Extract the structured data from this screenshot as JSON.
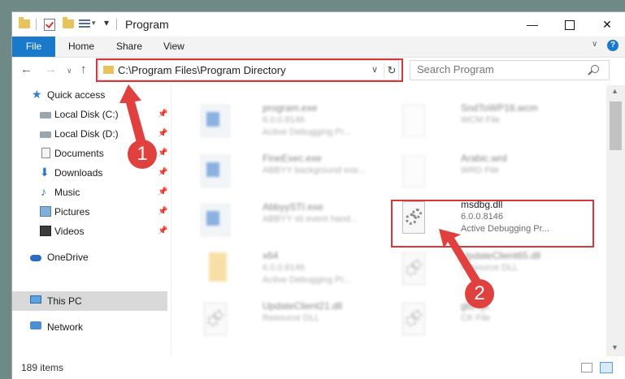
{
  "window": {
    "title": "Program",
    "minimize_glyph": "—",
    "close_glyph": "✕"
  },
  "ribbon": {
    "tabs": [
      "File",
      "Home",
      "Share",
      "View"
    ],
    "help_glyph": "?"
  },
  "address": {
    "path": "C:\\Program Files\\Program Directory",
    "dropdown_glyph": "∨",
    "refresh_glyph": "↻"
  },
  "search": {
    "placeholder": "Search Program"
  },
  "sidebar": {
    "items": [
      {
        "label": "Quick access",
        "icon": "star-icon",
        "pinned": false
      },
      {
        "label": "Local Disk (C:)",
        "icon": "drive-icon",
        "pinned": true
      },
      {
        "label": "Local Disk (D:)",
        "icon": "drive-icon",
        "pinned": true
      },
      {
        "label": "Documents",
        "icon": "documents-icon",
        "pinned": true
      },
      {
        "label": "Downloads",
        "icon": "download-icon",
        "pinned": true
      },
      {
        "label": "Music",
        "icon": "music-icon",
        "pinned": true
      },
      {
        "label": "Pictures",
        "icon": "pictures-icon",
        "pinned": true
      },
      {
        "label": "Videos",
        "icon": "videos-icon",
        "pinned": true
      },
      {
        "label": "OneDrive",
        "icon": "cloud-icon",
        "pinned": false
      },
      {
        "label": "This PC",
        "icon": "computer-icon",
        "pinned": false,
        "selected": true
      },
      {
        "label": "Network",
        "icon": "network-icon",
        "pinned": false
      }
    ]
  },
  "files": [
    {
      "name": "program.exe",
      "version": "6.0.0.8146",
      "desc": "Active Debugging Pr...",
      "type": "exe"
    },
    {
      "name": "SndToWP16.wcm",
      "version": "WCM File",
      "desc": "",
      "type": "page"
    },
    {
      "name": "FineExec.exe",
      "version": "ABBYY background exe...",
      "desc": "",
      "type": "exe"
    },
    {
      "name": "Arabic.wrd",
      "version": "WRD File",
      "desc": "",
      "type": "page"
    },
    {
      "name": "AbbyySTI.exe",
      "version": "ABBYY sti event hand...",
      "desc": "",
      "type": "exe"
    },
    {
      "name": "msdbg.dll",
      "version": "6.0.0.8146",
      "desc": "Active Debugging Pr...",
      "type": "dll",
      "focused": true
    },
    {
      "name": "x64",
      "version": "6.0.0.8146",
      "desc": "Active Debugging Pr...",
      "type": "folder"
    },
    {
      "name": "UpdateClient65.dll",
      "version": "Resource DLL",
      "desc": "",
      "type": "dll"
    },
    {
      "name": "UpdateClient21.dll",
      "version": "Resource DLL",
      "desc": "",
      "type": "dll"
    },
    {
      "name": "gtd.cjk",
      "version": "CK File",
      "desc": "",
      "type": "dll"
    }
  ],
  "status": {
    "item_count": "189 items"
  },
  "annotations": {
    "step1": "1",
    "step2": "2"
  },
  "colors": {
    "accent": "#1979ca",
    "annotation": "#e0413f",
    "selection": "#d9d9d9"
  }
}
